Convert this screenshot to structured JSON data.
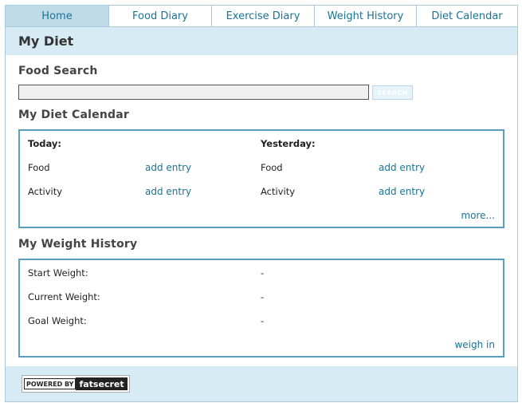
{
  "tabs": [
    {
      "label": "Home",
      "active": true
    },
    {
      "label": "Food Diary",
      "active": false
    },
    {
      "label": "Exercise Diary",
      "active": false
    },
    {
      "label": "Weight History",
      "active": false
    },
    {
      "label": "Diet Calendar",
      "active": false
    }
  ],
  "header": {
    "title": "My Diet"
  },
  "food_search": {
    "title": "Food Search",
    "input_value": "",
    "button_label": "SEARCH"
  },
  "diet_calendar": {
    "title": "My Diet Calendar",
    "today_label": "Today:",
    "yesterday_label": "Yesterday:",
    "rows": [
      {
        "label": "Food",
        "today_link": "add entry",
        "yesterday_link": "add entry"
      },
      {
        "label": "Activity",
        "today_link": "add entry",
        "yesterday_link": "add entry"
      }
    ],
    "more_link": "more..."
  },
  "weight_history": {
    "title": "My Weight History",
    "rows": [
      {
        "label": "Start Weight:",
        "value": "-"
      },
      {
        "label": "Current Weight:",
        "value": "-"
      },
      {
        "label": "Goal Weight:",
        "value": "-"
      }
    ],
    "weigh_in_link": "weigh in"
  },
  "footer": {
    "powered_by": "POWERED BY",
    "brand": "fatsecret"
  },
  "colors": {
    "accent": "#1a7395",
    "border": "#5a9ec0",
    "header_bg": "#d7ebf5",
    "active_tab": "#c0dbe8"
  }
}
